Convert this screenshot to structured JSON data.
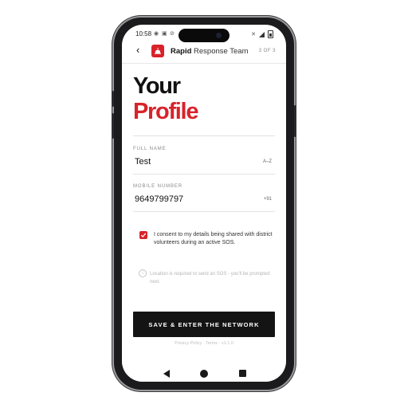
{
  "status": {
    "time": "10:58"
  },
  "appbar": {
    "brand_bold": "Rapid",
    "brand_rest": " Response Team",
    "step": "3 OF 3"
  },
  "title": {
    "line1": "Your",
    "line2": "Profile"
  },
  "fields": {
    "full_name": {
      "label": "FULL NAME",
      "value": "Test",
      "hint": "A–Z"
    },
    "mobile": {
      "label": "MOBILE NUMBER",
      "value": "9649799797",
      "hint": "+91"
    }
  },
  "consent": {
    "checked": true,
    "text": "I consent to my details being shared with district volunteers during an active SOS."
  },
  "info": {
    "text": "Location is required to send an SOS - you'll be prompted next."
  },
  "cta": {
    "label": "SAVE & ENTER THE NETWORK"
  },
  "footer": {
    "text": "Privacy Policy · Terms · v1.1.0"
  },
  "colors": {
    "accent": "#d8232a",
    "cta_bg": "#141414"
  },
  "icons": [
    "back-arrow-icon",
    "brand-logo-icon",
    "checkmark-icon",
    "info-icon",
    "nav-back-icon",
    "nav-home-icon",
    "nav-recents-icon"
  ]
}
